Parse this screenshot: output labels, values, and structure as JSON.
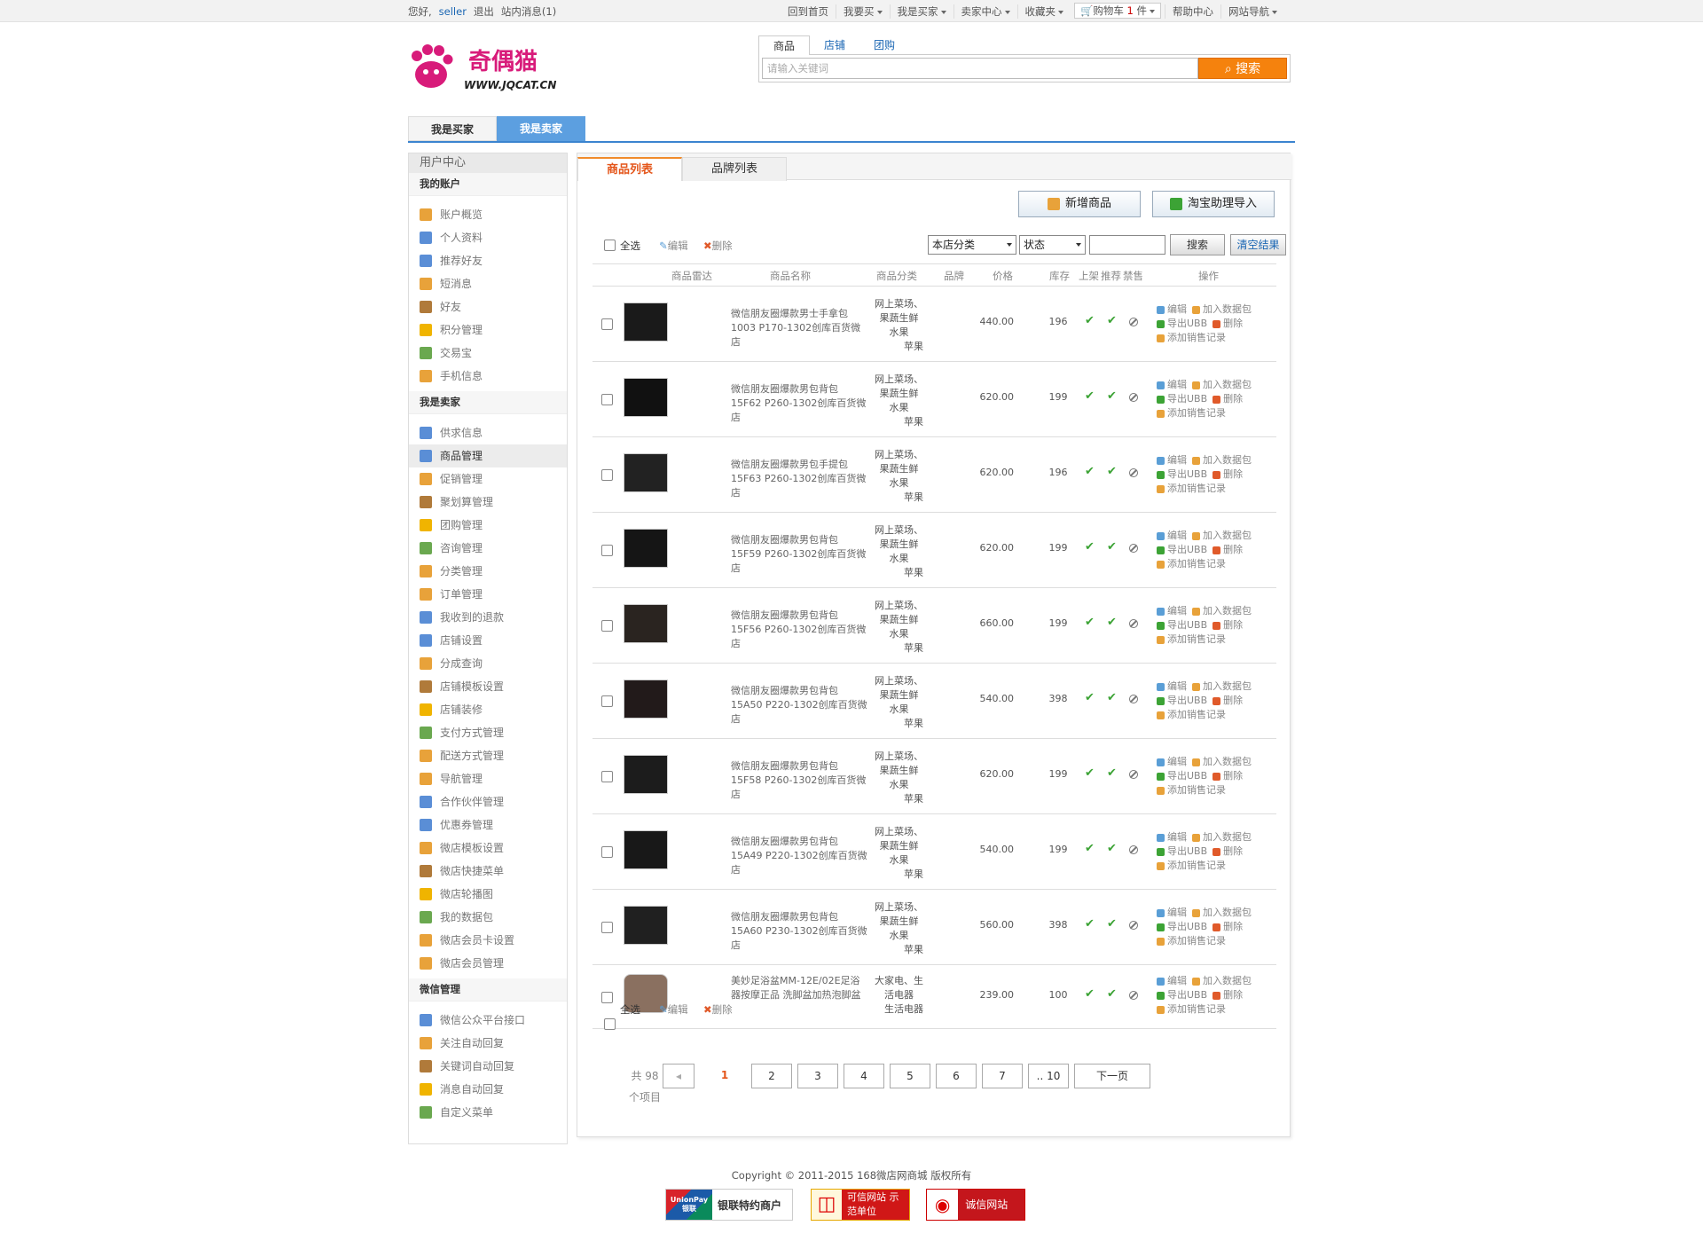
{
  "topbar": {
    "greeting": "您好,",
    "username": "seller",
    "logout": "退出",
    "messages": "站内消息(1)",
    "nav": [
      "回到首页",
      "我要买",
      "我是买家",
      "卖家中心",
      "收藏夹",
      "购物车",
      "帮助中心",
      "网站导航"
    ],
    "cart_count": "1",
    "cart_unit": "件"
  },
  "logo": {
    "brand": "奇偶猫",
    "url_text": "WWW.JQCAT.CN"
  },
  "search": {
    "tabs": [
      "商品",
      "店铺",
      "团购"
    ],
    "placeholder": "请输入关键词",
    "button": "搜索"
  },
  "role_tabs": [
    "我是买家",
    "我是卖家"
  ],
  "sidebar": {
    "title": "用户中心",
    "sections": [
      {
        "title": "我的账户",
        "items": [
          "账户概览",
          "个人资料",
          "推荐好友",
          "短消息",
          "好友",
          "积分管理",
          "交易宝",
          "手机信息"
        ]
      },
      {
        "title": "我是卖家",
        "items": [
          "供求信息",
          "商品管理",
          "促销管理",
          "聚划算管理",
          "团购管理",
          "咨询管理",
          "分类管理",
          "订单管理",
          "我收到的退款",
          "店铺设置",
          "分成查询",
          "店铺模板设置",
          "店铺装修",
          "支付方式管理",
          "配送方式管理",
          "导航管理",
          "合作伙伴管理",
          "优惠券管理",
          "微店模板设置",
          "微店快捷菜单",
          "微店轮播图",
          "我的数据包",
          "微店会员卡设置",
          "微店会员管理"
        ]
      },
      {
        "title": "微信管理",
        "items": [
          "微信公众平台接口",
          "关注自动回复",
          "关键词自动回复",
          "消息自动回复",
          "自定义菜单"
        ]
      }
    ]
  },
  "main": {
    "tabs": [
      "商品列表",
      "品牌列表"
    ],
    "add_button": "新增商品",
    "import_button": "淘宝助理导入",
    "toolbar": {
      "select_all": "全选",
      "edit": "编辑",
      "delete": "删除",
      "category_select": "本店分类",
      "status_select": "状态",
      "search_btn": "搜索",
      "clear_btn": "清空结果"
    },
    "columns": [
      "商品雷达",
      "商品名称",
      "商品分类",
      "品牌",
      "价格",
      "库存",
      "上架",
      "推荐",
      "禁售",
      "操作"
    ],
    "ops": {
      "edit": "编辑",
      "add_pack": "加入数据包",
      "export": "导出UBB",
      "delete": "删除",
      "add_sales": "添加销售记录"
    },
    "products": [
      {
        "name": "微信朋友圈爆款男士手拿包1003 P170-1302创库百货微店",
        "category": [
          "网上菜场、",
          "果蔬生鲜",
          "水果",
          "苹果"
        ],
        "price": "440.00",
        "stock": "196"
      },
      {
        "name": "微信朋友圈爆款男包背包15F62 P260-1302创库百货微店",
        "category": [
          "网上菜场、",
          "果蔬生鲜",
          "水果",
          "苹果"
        ],
        "price": "620.00",
        "stock": "199"
      },
      {
        "name": "微信朋友圈爆款男包手提包15F63 P260-1302创库百货微店",
        "category": [
          "网上菜场、",
          "果蔬生鲜",
          "水果",
          "苹果"
        ],
        "price": "620.00",
        "stock": "196"
      },
      {
        "name": "微信朋友圈爆款男包背包15F59 P260-1302创库百货微店",
        "category": [
          "网上菜场、",
          "果蔬生鲜",
          "水果",
          "苹果"
        ],
        "price": "620.00",
        "stock": "199"
      },
      {
        "name": "微信朋友圈爆款男包背包15F56 P260-1302创库百货微店",
        "category": [
          "网上菜场、",
          "果蔬生鲜",
          "水果",
          "苹果"
        ],
        "price": "660.00",
        "stock": "199"
      },
      {
        "name": "微信朋友圈爆款男包背包15A50 P220-1302创库百货微店",
        "category": [
          "网上菜场、",
          "果蔬生鲜",
          "水果",
          "苹果"
        ],
        "price": "540.00",
        "stock": "398"
      },
      {
        "name": "微信朋友圈爆款男包背包15F58 P260-1302创库百货微店",
        "category": [
          "网上菜场、",
          "果蔬生鲜",
          "水果",
          "苹果"
        ],
        "price": "620.00",
        "stock": "199"
      },
      {
        "name": "微信朋友圈爆款男包背包15A49 P220-1302创库百货微店",
        "category": [
          "网上菜场、",
          "果蔬生鲜",
          "水果",
          "苹果"
        ],
        "price": "540.00",
        "stock": "199"
      },
      {
        "name": "微信朋友圈爆款男包背包15A60 P230-1302创库百货微店",
        "category": [
          "网上菜场、",
          "果蔬生鲜",
          "水果",
          "苹果"
        ],
        "price": "560.00",
        "stock": "398"
      },
      {
        "name": "美妙足浴盆MM-12E/02E足浴器按摩正品 洗脚盆加热泡脚盆",
        "category": [
          "大家电、生",
          "活电器",
          "生活电器"
        ],
        "price": "239.00",
        "stock": "100"
      }
    ],
    "pager": {
      "total_prefix": "共 98",
      "total_suffix": "个项目",
      "pages": [
        "1",
        "2",
        "3",
        "4",
        "5",
        "6",
        "7",
        ".. 10"
      ],
      "next": "下一页"
    }
  },
  "footer": {
    "copyright": "Copyright © 2011-2015 168微店网商城 版权所有",
    "badges": [
      "银联特约商户",
      "可信网站 示范单位",
      "诚信网站"
    ],
    "unionpay": "UnionPay 银联"
  },
  "colors": {
    "accent_blue": "#3b84cf",
    "search_orange": "#f5820d",
    "active_tab_orange": "#e4561b",
    "check_green": "#3ca335"
  }
}
